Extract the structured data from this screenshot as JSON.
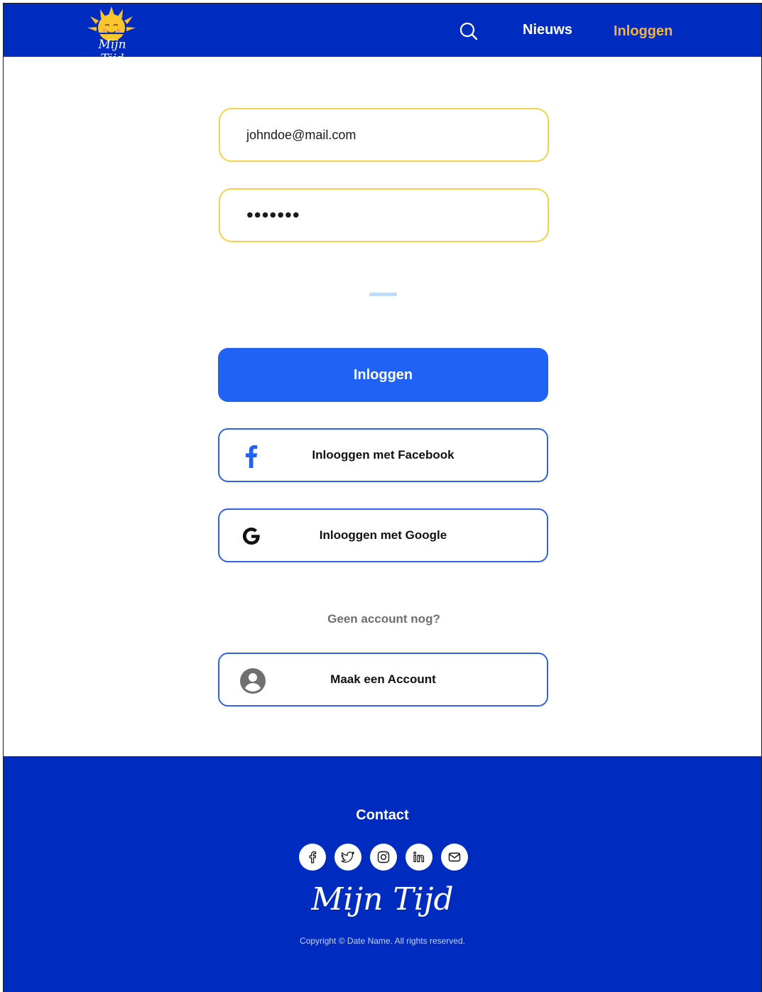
{
  "header": {
    "logo_text": "Mijn Tijd",
    "nav": {
      "news": "Nieuws",
      "login": "Inloggen"
    }
  },
  "form": {
    "email_value": "johndoe@mail.com",
    "password_value": "•••••••",
    "login_button": "Inloggen",
    "facebook_button": "Inlooggen met  Facebook",
    "google_button": "Inlooggen met  Google",
    "no_account_text": "Geen account nog?",
    "create_account_button": "Maak een Account"
  },
  "footer": {
    "contact_title": "Contact",
    "logo_text": "Mijn Tijd",
    "copyright": "Copyright © Date Name. All rights reserved.",
    "socials": [
      "facebook-icon",
      "twitter-icon",
      "instagram-icon",
      "linkedin-icon",
      "mail-icon"
    ]
  },
  "colors": {
    "brand_blue": "#002BBF",
    "primary_button": "#1F62F5",
    "accent_yellow": "#F6B33A",
    "field_border": "#F7D14B",
    "outline_border": "#2F62E6"
  }
}
